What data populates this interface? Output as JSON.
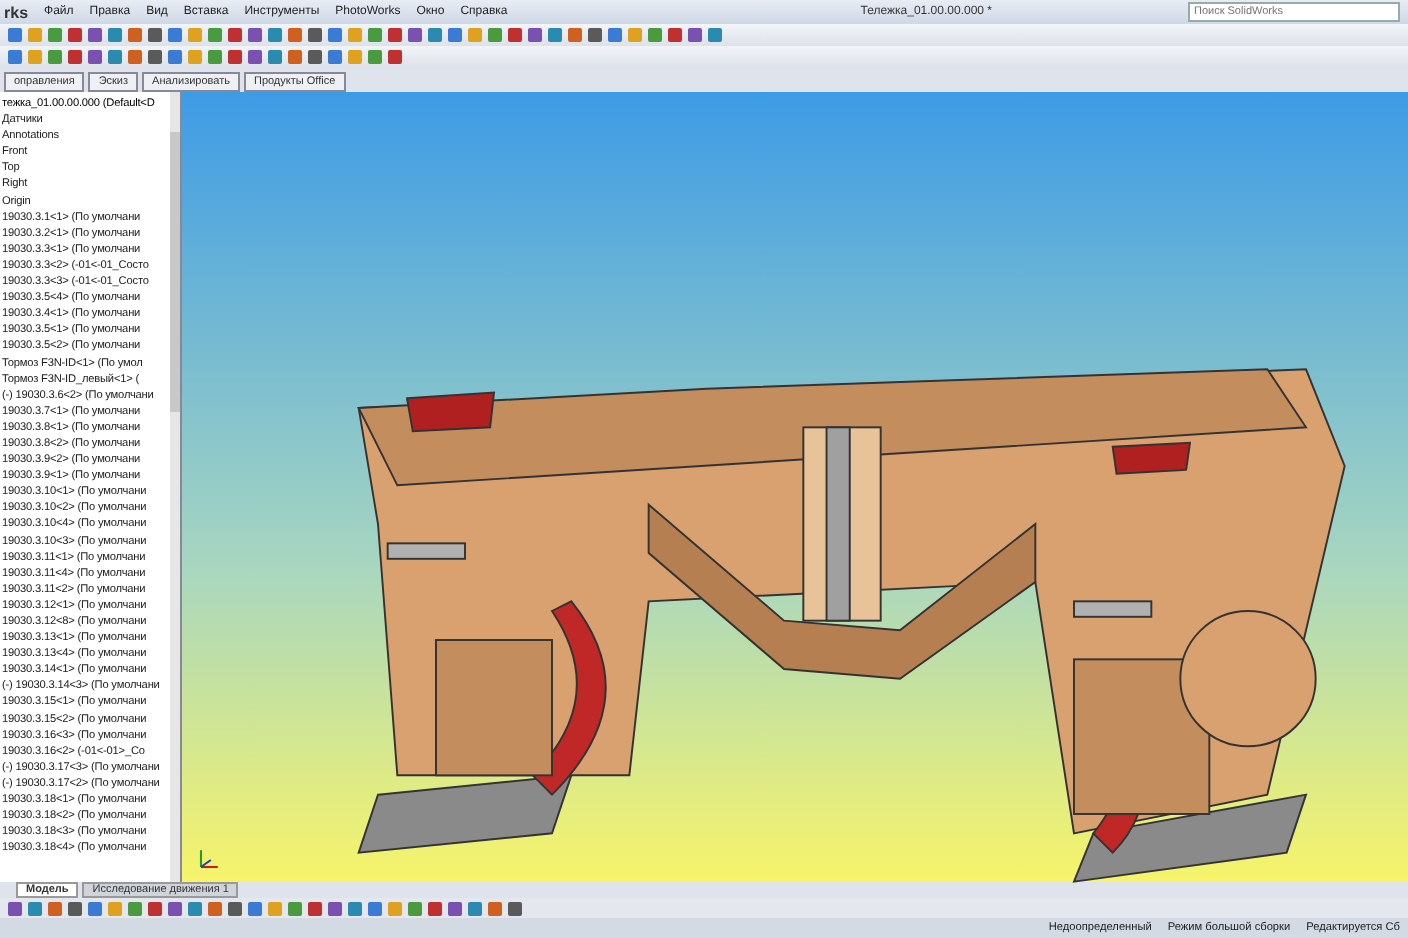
{
  "menu": {
    "app_title": "rks",
    "items": [
      "Файл",
      "Правка",
      "Вид",
      "Вставка",
      "Инструменты",
      "PhotoWorks",
      "Окно",
      "Справка"
    ]
  },
  "window": {
    "title": "Тележка_01.00.00.000 *"
  },
  "search": {
    "placeholder": "Поиск SolidWorks"
  },
  "command_tabs": [
    "оправления",
    "Эскиз",
    "Анализировать",
    "Продукты Office"
  ],
  "tree": {
    "root": "тежка_01.00.00.000 (Default<D",
    "items": [
      "Датчики",
      "Annotations",
      "Front",
      "Top",
      "Right",
      "Origin",
      "19030.3.1<1> (По умолчани",
      "19030.3.2<1> (По умолчани",
      "19030.3.3<1> (По умолчани",
      "19030.3.3<2> (-01<-01_Состо",
      "19030.3.3<3> (-01<-01_Состо",
      "19030.3.5<4> (По умолчани",
      "19030.3.4<1> (По умолчани",
      "19030.3.5<1> (По умолчани",
      "19030.3.5<2> (По умолчани",
      "Тормоз F3N-ID<1> (По умол",
      "Тормоз F3N-ID_левый<1> (",
      "(-) 19030.3.6<2> (По умолчани",
      "19030.3.7<1> (По умолчани",
      "19030.3.8<1> (По умолчани",
      "19030.3.8<2> (По умолчани",
      "19030.3.9<2> (По умолчани",
      "19030.3.9<1> (По умолчани",
      "19030.3.10<1> (По умолчани",
      "19030.3.10<2> (По умолчани",
      "19030.3.10<4> (По умолчани",
      "19030.3.10<3> (По умолчани",
      "19030.3.11<1> (По умолчани",
      "19030.3.11<4> (По умолчани",
      "19030.3.11<2> (По умолчани",
      "19030.3.12<1> (По умолчани",
      "19030.3.12<8> (По умолчани",
      "19030.3.13<1> (По умолчани",
      "19030.3.13<4> (По умолчани",
      "19030.3.14<1> (По умолчани",
      "(-) 19030.3.14<3> (По умолчани",
      "19030.3.15<1> (По умолчани",
      "19030.3.15<2> (По умолчани",
      "19030.3.16<3> (По умолчани",
      "19030.3.16<2> (-01<-01>_Co",
      "(-) 19030.3.17<3> (По умолчани",
      "(-) 19030.3.17<2> (По умолчани",
      "19030.3.18<1> (По умолчани",
      "19030.3.18<2> (По умолчани",
      "19030.3.18<3> (По умолчани",
      "19030.3.18<4> (По умолчани"
    ]
  },
  "bottom_tabs": [
    {
      "label": "Модель",
      "selected": true
    },
    {
      "label": "Исследование движения 1",
      "selected": false
    }
  ],
  "status": [
    "Недоопределенный",
    "Режим большой сборки",
    "Редактируется Сб"
  ]
}
